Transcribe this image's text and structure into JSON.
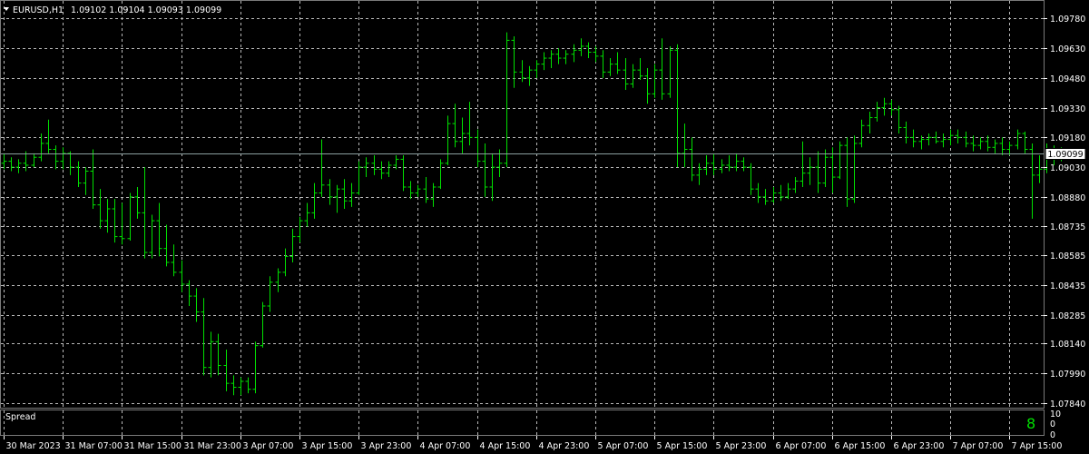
{
  "header": {
    "symbol": "EURUSD,H1",
    "ohlc": "1.09102 1.09104 1.09093 1.09099"
  },
  "current_price_label": "1.09099",
  "subwindow": {
    "title": "Spread",
    "value": "8",
    "axis_ticks": [
      "10",
      "0",
      "0"
    ]
  },
  "colors": {
    "background": "#000000",
    "bars": "#00e000",
    "grid": "#b9b9b9",
    "price_line": "#8ca0a0",
    "text": "#ffffff"
  },
  "chart_data": {
    "type": "ohlc",
    "ylim": [
      1.0784,
      1.098
    ],
    "y_ticks": [
      1.0978,
      1.0963,
      1.0948,
      1.0933,
      1.0918,
      1.0903,
      1.0888,
      1.08735,
      1.08585,
      1.08435,
      1.08285,
      1.0814,
      1.0799,
      1.0784
    ],
    "y_tick_labels": [
      "1.09780",
      "1.09630",
      "1.09480",
      "1.09330",
      "1.09180",
      "1.09030",
      "1.08880",
      "1.08735",
      "1.08585",
      "1.08435",
      "1.08285",
      "1.08140",
      "1.07990",
      "1.07840"
    ],
    "x_tick_labels": [
      "30 Mar 2023",
      "31 Mar 07:00",
      "31 Mar 15:00",
      "31 Mar 23:00",
      "3 Apr 07:00",
      "3 Apr 15:00",
      "3 Apr 23:00",
      "4 Apr 07:00",
      "4 Apr 15:00",
      "4 Apr 23:00",
      "5 Apr 07:00",
      "5 Apr 15:00",
      "5 Apr 23:00",
      "6 Apr 07:00",
      "6 Apr 15:00",
      "6 Apr 23:00",
      "7 Apr 07:00",
      "7 Apr 15:00"
    ],
    "x_tick_bar_index": [
      0,
      8,
      16,
      24,
      32,
      40,
      48,
      56,
      64,
      72,
      80,
      88,
      96,
      104,
      112,
      120,
      128,
      136
    ],
    "current_price": 1.09099,
    "bars": [
      [
        1.0905,
        1.091,
        1.0902,
        1.0906
      ],
      [
        1.0906,
        1.0908,
        1.0901,
        1.0903
      ],
      [
        1.0903,
        1.0907,
        1.09,
        1.0905
      ],
      [
        1.0905,
        1.0911,
        1.0901,
        1.0904
      ],
      [
        1.0904,
        1.091,
        1.0903,
        1.0908
      ],
      [
        1.0908,
        1.092,
        1.0906,
        1.0915
      ],
      [
        1.0915,
        1.0927,
        1.091,
        1.0912
      ],
      [
        1.0912,
        1.0914,
        1.0902,
        1.0906
      ],
      [
        1.0906,
        1.0913,
        1.0902,
        1.091
      ],
      [
        1.091,
        1.0911,
        1.0899,
        1.0903
      ],
      [
        1.0903,
        1.0906,
        1.0893,
        1.0895
      ],
      [
        1.0895,
        1.0903,
        1.0889,
        1.0901
      ],
      [
        1.0901,
        1.0912,
        1.0882,
        1.0884
      ],
      [
        1.0884,
        1.0892,
        1.0872,
        1.0876
      ],
      [
        1.0876,
        1.0887,
        1.087,
        1.0882
      ],
      [
        1.0882,
        1.0887,
        1.0865,
        1.0868
      ],
      [
        1.0868,
        1.0885,
        1.0864,
        1.0867
      ],
      [
        1.0867,
        1.089,
        1.0866,
        1.0888
      ],
      [
        1.0888,
        1.0893,
        1.0877,
        1.088
      ],
      [
        1.088,
        1.0903,
        1.0857,
        1.086
      ],
      [
        1.086,
        1.0879,
        1.0857,
        1.0876
      ],
      [
        1.0876,
        1.0885,
        1.0858,
        1.0862
      ],
      [
        1.0862,
        1.0874,
        1.0853,
        1.0855
      ],
      [
        1.0855,
        1.0864,
        1.0848,
        1.085
      ],
      [
        1.085,
        1.0856,
        1.084,
        1.0844
      ],
      [
        1.0844,
        1.0846,
        1.0833,
        1.0838
      ],
      [
        1.0838,
        1.0842,
        1.0825,
        1.083
      ],
      [
        1.083,
        1.0837,
        1.0798,
        1.0802
      ],
      [
        1.0802,
        1.082,
        1.0797,
        1.0815
      ],
      [
        1.0815,
        1.0819,
        1.0798,
        1.0803
      ],
      [
        1.0803,
        1.0811,
        1.079,
        1.0794
      ],
      [
        1.0794,
        1.0798,
        1.0788,
        1.0792
      ],
      [
        1.0792,
        1.0797,
        1.0788,
        1.0795
      ],
      [
        1.0795,
        1.0797,
        1.0789,
        1.0791
      ],
      [
        1.0791,
        1.0815,
        1.0789,
        1.0813
      ],
      [
        1.0813,
        1.0835,
        1.0812,
        1.0833
      ],
      [
        1.0833,
        1.0848,
        1.083,
        1.0845
      ],
      [
        1.0845,
        1.0852,
        1.084,
        1.085
      ],
      [
        1.085,
        1.0862,
        1.0848,
        1.0858
      ],
      [
        1.0858,
        1.0872,
        1.0855,
        1.0868
      ],
      [
        1.0868,
        1.0878,
        1.0865,
        1.0876
      ],
      [
        1.0876,
        1.0885,
        1.0873,
        1.088
      ],
      [
        1.088,
        1.0895,
        1.0877,
        1.089
      ],
      [
        1.089,
        1.0917,
        1.0888,
        1.0894
      ],
      [
        1.0894,
        1.0897,
        1.0884,
        1.0888
      ],
      [
        1.0888,
        1.0894,
        1.088,
        1.0892
      ],
      [
        1.0892,
        1.0897,
        1.0882,
        1.0886
      ],
      [
        1.0886,
        1.0895,
        1.0883,
        1.089
      ],
      [
        1.089,
        1.0906,
        1.0889,
        1.0903
      ],
      [
        1.0903,
        1.0908,
        1.0898,
        1.0905
      ],
      [
        1.0905,
        1.0909,
        1.0899,
        1.0902
      ],
      [
        1.0902,
        1.0906,
        1.0897,
        1.09
      ],
      [
        1.09,
        1.0906,
        1.0898,
        1.0904
      ],
      [
        1.0904,
        1.0909,
        1.0902,
        1.0907
      ],
      [
        1.0907,
        1.0909,
        1.0891,
        1.0893
      ],
      [
        1.0893,
        1.0896,
        1.0887,
        1.089
      ],
      [
        1.089,
        1.0894,
        1.0888,
        1.0892
      ],
      [
        1.0892,
        1.0898,
        1.0885,
        1.0887
      ],
      [
        1.0887,
        1.0895,
        1.0883,
        1.0893
      ],
      [
        1.0893,
        1.0907,
        1.0892,
        1.0905
      ],
      [
        1.0905,
        1.0929,
        1.0904,
        1.0925
      ],
      [
        1.0925,
        1.0935,
        1.0913,
        1.0916
      ],
      [
        1.0916,
        1.0928,
        1.091,
        1.092
      ],
      [
        1.092,
        1.0936,
        1.0914,
        1.0918
      ],
      [
        1.0918,
        1.0922,
        1.0903,
        1.0906
      ],
      [
        1.0906,
        1.0915,
        1.0888,
        1.0893
      ],
      [
        1.0893,
        1.091,
        1.0886,
        1.0903
      ],
      [
        1.0903,
        1.0912,
        1.0898,
        1.0905
      ],
      [
        1.0905,
        1.0971,
        1.0903,
        1.0967
      ],
      [
        1.0967,
        1.0969,
        1.0943,
        1.0951
      ],
      [
        1.0951,
        1.0957,
        1.0946,
        1.0948
      ],
      [
        1.0948,
        1.0954,
        1.0944,
        1.0952
      ],
      [
        1.0952,
        1.0957,
        1.0948,
        1.0955
      ],
      [
        1.0955,
        1.0961,
        1.0952,
        1.0958
      ],
      [
        1.0958,
        1.0962,
        1.0953,
        1.096
      ],
      [
        1.096,
        1.0963,
        1.0955,
        1.0958
      ],
      [
        1.0958,
        1.0962,
        1.0955,
        1.096
      ],
      [
        1.096,
        1.0965,
        1.0956,
        1.0962
      ],
      [
        1.0962,
        1.0968,
        1.0959,
        1.0964
      ],
      [
        1.0964,
        1.0966,
        1.0958,
        1.0961
      ],
      [
        1.0961,
        1.0964,
        1.0956,
        1.0959
      ],
      [
        1.0959,
        1.0962,
        1.0948,
        1.0951
      ],
      [
        1.0951,
        1.0958,
        1.0949,
        1.0955
      ],
      [
        1.0955,
        1.0961,
        1.095,
        1.0952
      ],
      [
        1.0952,
        1.0958,
        1.0942,
        1.0945
      ],
      [
        1.0945,
        1.0955,
        1.0943,
        1.0952
      ],
      [
        1.0952,
        1.0958,
        1.0947,
        1.0949
      ],
      [
        1.0949,
        1.0953,
        1.0935,
        1.094
      ],
      [
        1.094,
        1.0955,
        1.0938,
        1.0952
      ],
      [
        1.0952,
        1.0968,
        1.0937,
        1.094
      ],
      [
        1.094,
        1.0964,
        1.0938,
        1.0962
      ],
      [
        1.0962,
        1.0965,
        1.0903,
        1.091
      ],
      [
        1.091,
        1.0925,
        1.0903,
        1.0912
      ],
      [
        1.0912,
        1.0918,
        1.0896,
        1.0899
      ],
      [
        1.0899,
        1.0905,
        1.0894,
        1.0902
      ],
      [
        1.0902,
        1.0909,
        1.0899,
        1.0905
      ],
      [
        1.0905,
        1.091,
        1.0899,
        1.0902
      ],
      [
        1.0902,
        1.0907,
        1.09,
        1.0904
      ],
      [
        1.0904,
        1.0909,
        1.0901,
        1.0903
      ],
      [
        1.0903,
        1.091,
        1.0901,
        1.0906
      ],
      [
        1.0906,
        1.0908,
        1.0901,
        1.0903
      ],
      [
        1.0903,
        1.0905,
        1.0889,
        1.0892
      ],
      [
        1.0892,
        1.0895,
        1.0885,
        1.0888
      ],
      [
        1.0888,
        1.0892,
        1.0884,
        1.0886
      ],
      [
        1.0886,
        1.0893,
        1.0885,
        1.089
      ],
      [
        1.089,
        1.0894,
        1.0886,
        1.0888
      ],
      [
        1.0888,
        1.0895,
        1.0887,
        1.0892
      ],
      [
        1.0892,
        1.0898,
        1.089,
        1.0896
      ],
      [
        1.0896,
        1.0916,
        1.0893,
        1.09
      ],
      [
        1.09,
        1.0908,
        1.0894,
        1.0903
      ],
      [
        1.0903,
        1.0911,
        1.089,
        1.0895
      ],
      [
        1.0895,
        1.0912,
        1.0893,
        1.0908
      ],
      [
        1.0908,
        1.0913,
        1.089,
        1.0898
      ],
      [
        1.0898,
        1.0916,
        1.0897,
        1.0914
      ],
      [
        1.0914,
        1.0918,
        1.0883,
        1.0887
      ],
      [
        1.0887,
        1.0919,
        1.0885,
        1.0915
      ],
      [
        1.0915,
        1.0927,
        1.0913,
        1.0924
      ],
      [
        1.0924,
        1.0931,
        1.092,
        1.0928
      ],
      [
        1.0928,
        1.0936,
        1.0926,
        1.0933
      ],
      [
        1.0933,
        1.0938,
        1.0929,
        1.0935
      ],
      [
        1.0935,
        1.0937,
        1.0929,
        1.0932
      ],
      [
        1.0932,
        1.0934,
        1.092,
        1.0923
      ],
      [
        1.0923,
        1.0926,
        1.0915,
        1.0918
      ],
      [
        1.0918,
        1.0922,
        1.0913,
        1.0916
      ],
      [
        1.0916,
        1.0919,
        1.0912,
        1.0917
      ],
      [
        1.0917,
        1.092,
        1.0914,
        1.0918
      ],
      [
        1.0918,
        1.0921,
        1.0915,
        1.0916
      ],
      [
        1.0916,
        1.092,
        1.0913,
        1.0917
      ],
      [
        1.0917,
        1.0922,
        1.0914,
        1.0919
      ],
      [
        1.0919,
        1.0922,
        1.0915,
        1.0918
      ],
      [
        1.0918,
        1.0921,
        1.0913,
        1.0915
      ],
      [
        1.0915,
        1.0919,
        1.0911,
        1.0914
      ],
      [
        1.0914,
        1.0918,
        1.0912,
        1.0916
      ],
      [
        1.0916,
        1.0919,
        1.0911,
        1.0913
      ],
      [
        1.0913,
        1.0917,
        1.091,
        1.0915
      ],
      [
        1.0915,
        1.0918,
        1.0909,
        1.0912
      ],
      [
        1.0912,
        1.0916,
        1.0909,
        1.0914
      ],
      [
        1.0914,
        1.0922,
        1.0912,
        1.092
      ],
      [
        1.092,
        1.0921,
        1.091,
        1.0912
      ],
      [
        1.0912,
        1.0915,
        1.0877,
        1.0899
      ],
      [
        1.0899,
        1.0909,
        1.0895,
        1.0902
      ],
      [
        1.0902,
        1.0915,
        1.09,
        1.0912
      ],
      [
        1.0912,
        1.0914,
        1.0904,
        1.0908
      ],
      [
        1.0908,
        1.0913,
        1.0906,
        1.091
      ],
      [
        1.091,
        1.0912,
        1.0907,
        1.0909
      ]
    ]
  }
}
